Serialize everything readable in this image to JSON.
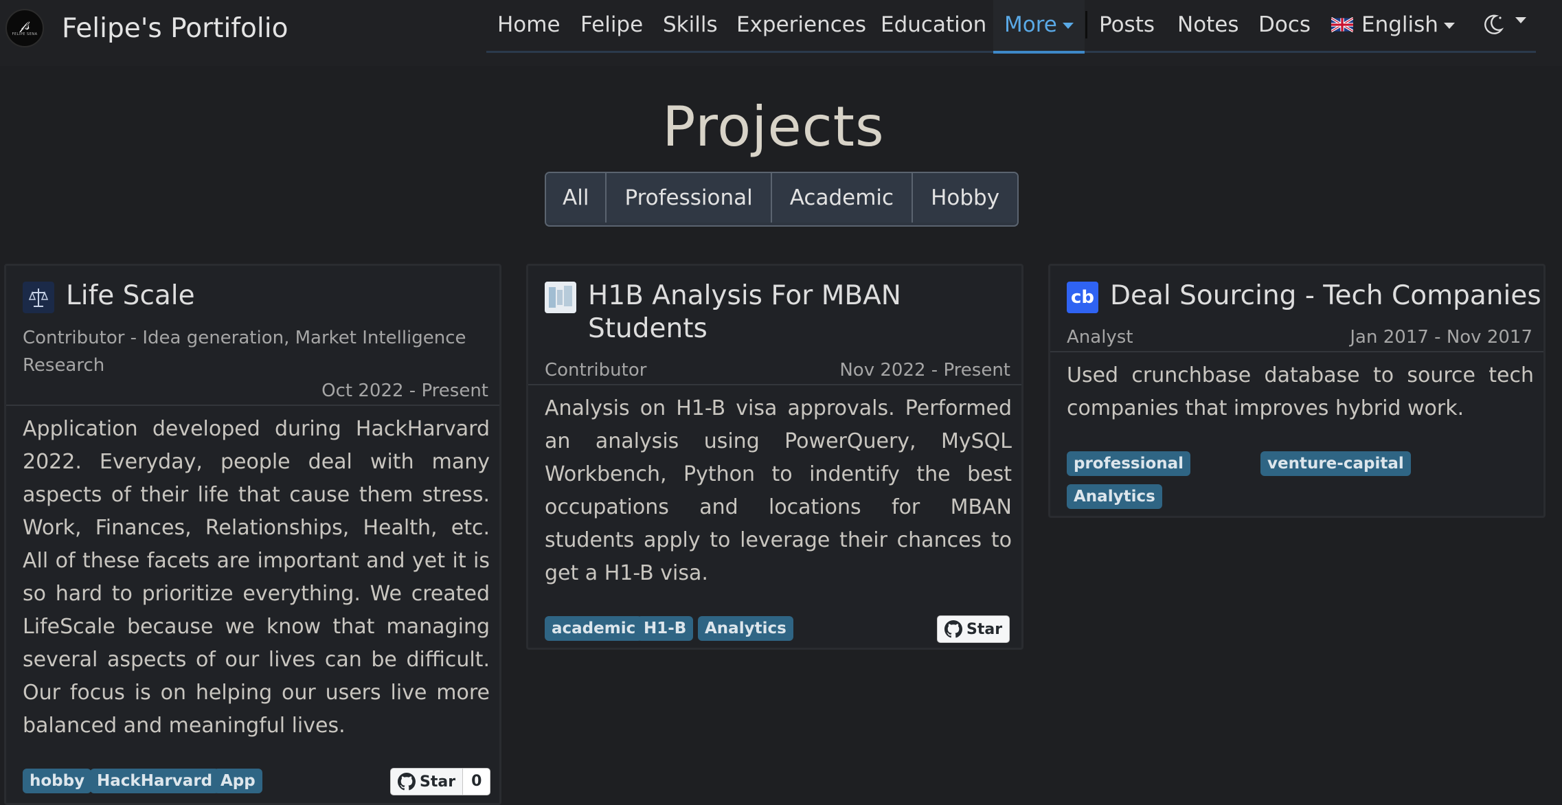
{
  "brand": {
    "name": "Felipe's Portifolio",
    "logo_signature": "𝒻𝓈",
    "logo_caption": "FELIPE SENA"
  },
  "nav": {
    "items": [
      "Home",
      "Felipe",
      "Skills",
      "Experiences",
      "Education",
      "More",
      "Posts",
      "Notes",
      "Docs"
    ],
    "active": "More",
    "language": "English",
    "accent_color": "#5aa9e6"
  },
  "page": {
    "title": "Projects",
    "filters": [
      "All",
      "Professional",
      "Academic",
      "Hobby"
    ]
  },
  "cards": [
    {
      "icon": "scale-logo-icon",
      "title": "Life Scale",
      "role": "Contributor - Idea generation, Market Intelligence Research",
      "date": "Oct 2022 - Present",
      "description": "Application developed during HackHarvard 2022. Everyday, people deal with many aspects of their life that cause them stress. Work, Finances, Relationships, Health, etc. All of these facets are important and yet it is so hard to prioritize everything. We created LifeScale because we know that managing several aspects of our lives can be difficult. Our focus is on helping our users live more balanced and meaningful lives.",
      "tags": [
        "hobby",
        "HackHarvard",
        "App"
      ],
      "star_label": "Star",
      "star_count": "0"
    },
    {
      "icon": "h1b-thumbnail-icon",
      "title": "H1B Analysis For MBAN Students",
      "role": "Contributor",
      "date": "Nov 2022 - Present",
      "description": "Analysis on H1-B visa approvals. Performed an analysis using PowerQuery, MySQL Workbench, Python to indentify the best occupations and locations for MBAN students apply to leverage their chances to get a H1-B visa.",
      "tags": [
        "academic",
        "H1-B",
        "Analytics"
      ],
      "star_label": "Star"
    },
    {
      "icon": "crunchbase-logo-icon",
      "icon_text": "cb",
      "title": "Deal Sourcing - Tech Companies",
      "role": "Analyst",
      "date": "Jan 2017 - Nov 2017",
      "description": "Used crunchbase database to source tech companies that improves hybrid work.",
      "tags": [
        "professional",
        "venture-capital",
        "Analytics"
      ]
    }
  ]
}
